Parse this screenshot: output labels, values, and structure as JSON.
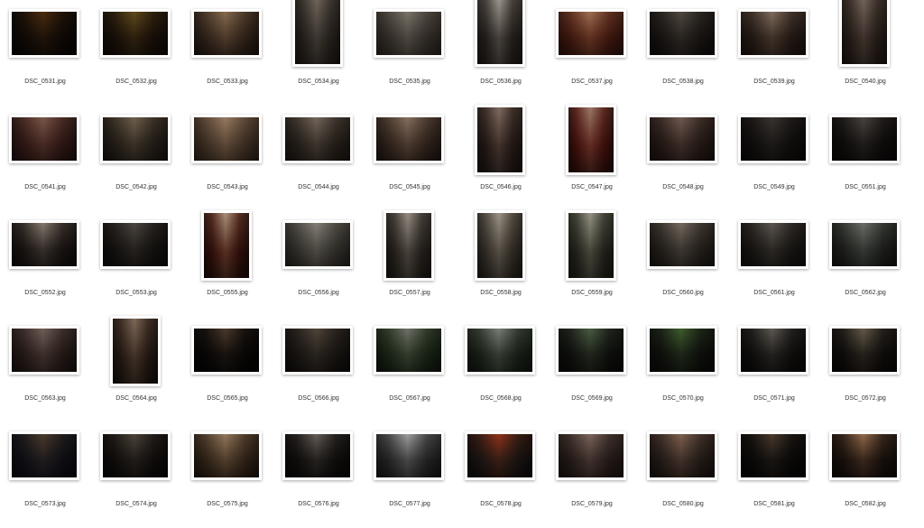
{
  "files": [
    {
      "name": "DSC_0531.jpg",
      "orientation": "landscape",
      "colors": [
        "#3a2e24",
        "#8a6a3c",
        "#1c1814"
      ]
    },
    {
      "name": "DSC_0532.jpg",
      "orientation": "landscape",
      "colors": [
        "#4a3a2a",
        "#9c8a54",
        "#2a241c"
      ]
    },
    {
      "name": "DSC_0533.jpg",
      "orientation": "landscape",
      "colors": [
        "#6a5a4c",
        "#b8a48e",
        "#3a302a"
      ]
    },
    {
      "name": "DSC_0534.jpg",
      "orientation": "portrait",
      "colors": [
        "#5c5650",
        "#a8a098",
        "#3a3430"
      ]
    },
    {
      "name": "DSC_0535.jpg",
      "orientation": "landscape",
      "colors": [
        "#6c6660",
        "#b0aca4",
        "#4a4440"
      ]
    },
    {
      "name": "DSC_0536.jpg",
      "orientation": "portrait",
      "colors": [
        "#5a5450",
        "#c8c4be",
        "#3c3834"
      ]
    },
    {
      "name": "DSC_0537.jpg",
      "orientation": "landscape",
      "colors": [
        "#7a4a3a",
        "#c8a890",
        "#4a2e24"
      ]
    },
    {
      "name": "DSC_0538.jpg",
      "orientation": "landscape",
      "colors": [
        "#4a4440",
        "#8e8880",
        "#2c2826"
      ]
    },
    {
      "name": "DSC_0539.jpg",
      "orientation": "landscape",
      "colors": [
        "#5a4c44",
        "#b4a69a",
        "#3a302c"
      ]
    },
    {
      "name": "DSC_0540.jpg",
      "orientation": "portrait",
      "colors": [
        "#5c5048",
        "#aaa098",
        "#3a322c"
      ]
    },
    {
      "name": "DSC_0541.jpg",
      "orientation": "landscape",
      "colors": [
        "#6a4a44",
        "#b09488",
        "#3c2c28"
      ]
    },
    {
      "name": "DSC_0542.jpg",
      "orientation": "landscape",
      "colors": [
        "#5a5248",
        "#a89c8c",
        "#36302a"
      ]
    },
    {
      "name": "DSC_0543.jpg",
      "orientation": "landscape",
      "colors": [
        "#7a6a5c",
        "#c4b09c",
        "#4c4238"
      ]
    },
    {
      "name": "DSC_0544.jpg",
      "orientation": "landscape",
      "colors": [
        "#5c544c",
        "#aca298",
        "#3a342e"
      ]
    },
    {
      "name": "DSC_0545.jpg",
      "orientation": "landscape",
      "colors": [
        "#6a5a50",
        "#b8a89a",
        "#3e342e"
      ]
    },
    {
      "name": "DSC_0546.jpg",
      "orientation": "portrait",
      "colors": [
        "#5a4a44",
        "#b4a69e",
        "#36302c"
      ]
    },
    {
      "name": "DSC_0547.jpg",
      "orientation": "portrait",
      "colors": [
        "#7a3c34",
        "#c8b0a4",
        "#3e2420"
      ]
    },
    {
      "name": "DSC_0548.jpg",
      "orientation": "landscape",
      "colors": [
        "#5c4c46",
        "#a89890",
        "#382e2a"
      ]
    },
    {
      "name": "DSC_0549.jpg",
      "orientation": "landscape",
      "colors": [
        "#3c3836",
        "#7a7470",
        "#24201e"
      ]
    },
    {
      "name": "DSC_0551.jpg",
      "orientation": "landscape",
      "colors": [
        "#3a3634",
        "#8a8480",
        "#201c1a"
      ]
    },
    {
      "name": "DSC_0552.jpg",
      "orientation": "landscape",
      "colors": [
        "#4c4440",
        "#b8b0a8",
        "#2a2624"
      ]
    },
    {
      "name": "DSC_0553.jpg",
      "orientation": "landscape",
      "colors": [
        "#44403c",
        "#8c8680",
        "#282422"
      ]
    },
    {
      "name": "DSC_0555.jpg",
      "orientation": "portrait",
      "colors": [
        "#6a3c30",
        "#d0c0b0",
        "#3a2620"
      ]
    },
    {
      "name": "DSC_0556.jpg",
      "orientation": "landscape",
      "colors": [
        "#6c6a64",
        "#b8b4ae",
        "#46423e"
      ]
    },
    {
      "name": "DSC_0557.jpg",
      "orientation": "portrait",
      "colors": [
        "#5c5650",
        "#c4beb8",
        "#3a3632"
      ]
    },
    {
      "name": "DSC_0558.jpg",
      "orientation": "portrait",
      "colors": [
        "#6a645c",
        "#c8c2ba",
        "#3e3a34"
      ]
    },
    {
      "name": "DSC_0559.jpg",
      "orientation": "portrait",
      "colors": [
        "#5a5a50",
        "#c4c2b8",
        "#3a3a32"
      ]
    },
    {
      "name": "DSC_0560.jpg",
      "orientation": "landscape",
      "colors": [
        "#5c5650",
        "#aca49c",
        "#38342e"
      ]
    },
    {
      "name": "DSC_0561.jpg",
      "orientation": "landscape",
      "colors": [
        "#4a4642",
        "#9a948e",
        "#2c2a26"
      ]
    },
    {
      "name": "DSC_0562.jpg",
      "orientation": "landscape",
      "colors": [
        "#545652",
        "#a4a8a2",
        "#323430"
      ]
    },
    {
      "name": "DSC_0563.jpg",
      "orientation": "landscape",
      "colors": [
        "#5c4c48",
        "#a89c96",
        "#38302c"
      ]
    },
    {
      "name": "DSC_0564.jpg",
      "orientation": "portrait",
      "colors": [
        "#5a4a40",
        "#b4a496",
        "#342c26"
      ]
    },
    {
      "name": "DSC_0565.jpg",
      "orientation": "landscape",
      "colors": [
        "#2a2624",
        "#8c7a6a",
        "#161412"
      ]
    },
    {
      "name": "DSC_0566.jpg",
      "orientation": "landscape",
      "colors": [
        "#4a4440",
        "#8e8478",
        "#2a2622"
      ]
    },
    {
      "name": "DSC_0567.jpg",
      "orientation": "landscape",
      "colors": [
        "#4a5a44",
        "#a8aaa2",
        "#2c3428"
      ]
    },
    {
      "name": "DSC_0568.jpg",
      "orientation": "landscape",
      "colors": [
        "#4c5448",
        "#b0b4ae",
        "#2e342c"
      ]
    },
    {
      "name": "DSC_0569.jpg",
      "orientation": "landscape",
      "colors": [
        "#3a3c38",
        "#8a9a80",
        "#22241e"
      ]
    },
    {
      "name": "DSC_0570.jpg",
      "orientation": "landscape",
      "colors": [
        "#3a3c36",
        "#7e9a6c",
        "#22241e"
      ]
    },
    {
      "name": "DSC_0571.jpg",
      "orientation": "landscape",
      "colors": [
        "#3a3836",
        "#9a9690",
        "#201e1c"
      ]
    },
    {
      "name": "DSC_0572.jpg",
      "orientation": "landscape",
      "colors": [
        "#3a3632",
        "#a09888",
        "#221e1c"
      ]
    },
    {
      "name": "DSC_0573.jpg",
      "orientation": "landscape",
      "colors": [
        "#3a3a44",
        "#8a7a6a",
        "#1e2030"
      ]
    },
    {
      "name": "DSC_0574.jpg",
      "orientation": "landscape",
      "colors": [
        "#3c3632",
        "#8c847a",
        "#201c1a"
      ]
    },
    {
      "name": "DSC_0575.jpg",
      "orientation": "landscape",
      "colors": [
        "#6a5a4a",
        "#c0ae98",
        "#3c3228"
      ]
    },
    {
      "name": "DSC_0576.jpg",
      "orientation": "landscape",
      "colors": [
        "#3a3634",
        "#a09a94",
        "#201e1c"
      ]
    },
    {
      "name": "DSC_0577.jpg",
      "orientation": "landscape",
      "colors": [
        "#5a5a5c",
        "#c8c8c8",
        "#363638"
      ]
    },
    {
      "name": "DSC_0578.jpg",
      "orientation": "landscape",
      "colors": [
        "#4a4442",
        "#c07050",
        "#2a2624"
      ]
    },
    {
      "name": "DSC_0579.jpg",
      "orientation": "landscape",
      "colors": [
        "#5c4e4a",
        "#b0a098",
        "#3a302c"
      ]
    },
    {
      "name": "DSC_0580.jpg",
      "orientation": "landscape",
      "colors": [
        "#5a504a",
        "#b49c8c",
        "#382e2a"
      ]
    },
    {
      "name": "DSC_0581.jpg",
      "orientation": "landscape",
      "colors": [
        "#2e2c2a",
        "#8a7a6c",
        "#1a1816"
      ]
    },
    {
      "name": "DSC_0582.jpg",
      "orientation": "landscape",
      "colors": [
        "#4a3c34",
        "#c0a488",
        "#2a221e"
      ]
    }
  ]
}
